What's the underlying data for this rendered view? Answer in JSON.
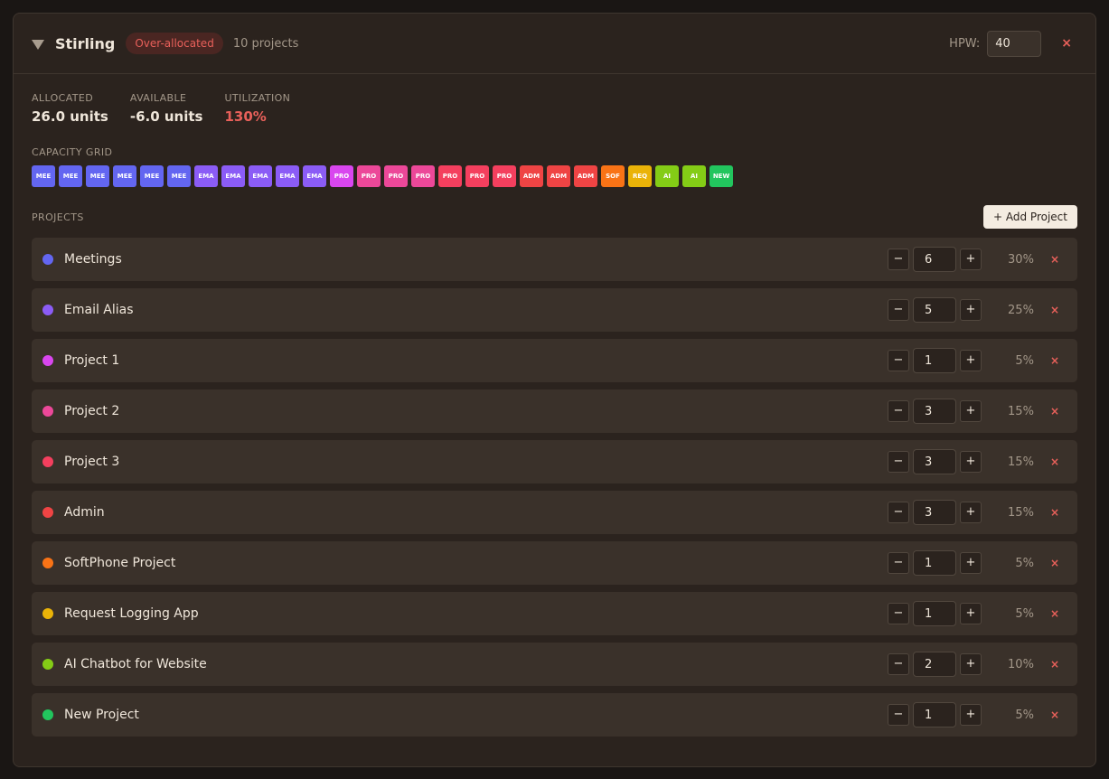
{
  "header": {
    "name": "Stirling",
    "status_badge": "Over-allocated",
    "project_count": "10 projects",
    "hpw_label": "HPW:",
    "hpw_value": "40",
    "close_label": "×"
  },
  "stats": {
    "allocated_label": "ALLOCATED",
    "allocated_value": "26.0 units",
    "available_label": "AVAILABLE",
    "available_value": "-6.0 units",
    "utilization_label": "UTILIZATION",
    "utilization_value": "130%"
  },
  "capacity_grid": {
    "label": "CAPACITY GRID",
    "cells": [
      {
        "label": "MEE",
        "color": "#6366f1"
      },
      {
        "label": "MEE",
        "color": "#6366f1"
      },
      {
        "label": "MEE",
        "color": "#6366f1"
      },
      {
        "label": "MEE",
        "color": "#6366f1"
      },
      {
        "label": "MEE",
        "color": "#6366f1"
      },
      {
        "label": "MEE",
        "color": "#6366f1"
      },
      {
        "label": "EMA",
        "color": "#8b5cf6"
      },
      {
        "label": "EMA",
        "color": "#8b5cf6"
      },
      {
        "label": "EMA",
        "color": "#8b5cf6"
      },
      {
        "label": "EMA",
        "color": "#8b5cf6"
      },
      {
        "label": "EMA",
        "color": "#8b5cf6"
      },
      {
        "label": "PRO",
        "color": "#d946ef"
      },
      {
        "label": "PRO",
        "color": "#ec4899"
      },
      {
        "label": "PRO",
        "color": "#ec4899"
      },
      {
        "label": "PRO",
        "color": "#ec4899"
      },
      {
        "label": "PRO",
        "color": "#f43f5e"
      },
      {
        "label": "PRO",
        "color": "#f43f5e"
      },
      {
        "label": "PRO",
        "color": "#f43f5e"
      },
      {
        "label": "ADM",
        "color": "#ef4444"
      },
      {
        "label": "ADM",
        "color": "#ef4444"
      },
      {
        "label": "ADM",
        "color": "#ef4444"
      },
      {
        "label": "SOF",
        "color": "#f97316"
      },
      {
        "label": "REQ",
        "color": "#eab308"
      },
      {
        "label": "AI",
        "color": "#84cc16"
      },
      {
        "label": "AI",
        "color": "#84cc16"
      },
      {
        "label": "NEW",
        "color": "#22c55e"
      }
    ]
  },
  "projects": {
    "label": "PROJECTS",
    "add_label": "+ Add Project",
    "minus_label": "−",
    "plus_label": "+",
    "remove_label": "×",
    "items": [
      {
        "name": "Meetings",
        "qty": "6",
        "pct": "30%",
        "color": "#6366f1"
      },
      {
        "name": "Email Alias",
        "qty": "5",
        "pct": "25%",
        "color": "#8b5cf6"
      },
      {
        "name": "Project 1",
        "qty": "1",
        "pct": "5%",
        "color": "#d946ef"
      },
      {
        "name": "Project 2",
        "qty": "3",
        "pct": "15%",
        "color": "#ec4899"
      },
      {
        "name": "Project 3",
        "qty": "3",
        "pct": "15%",
        "color": "#f43f5e"
      },
      {
        "name": "Admin",
        "qty": "3",
        "pct": "15%",
        "color": "#ef4444"
      },
      {
        "name": "SoftPhone Project",
        "qty": "1",
        "pct": "5%",
        "color": "#f97316"
      },
      {
        "name": "Request Logging App",
        "qty": "1",
        "pct": "5%",
        "color": "#eab308"
      },
      {
        "name": "AI Chatbot for Website",
        "qty": "2",
        "pct": "10%",
        "color": "#84cc16"
      },
      {
        "name": "New Project",
        "qty": "1",
        "pct": "5%",
        "color": "#22c55e"
      }
    ]
  }
}
